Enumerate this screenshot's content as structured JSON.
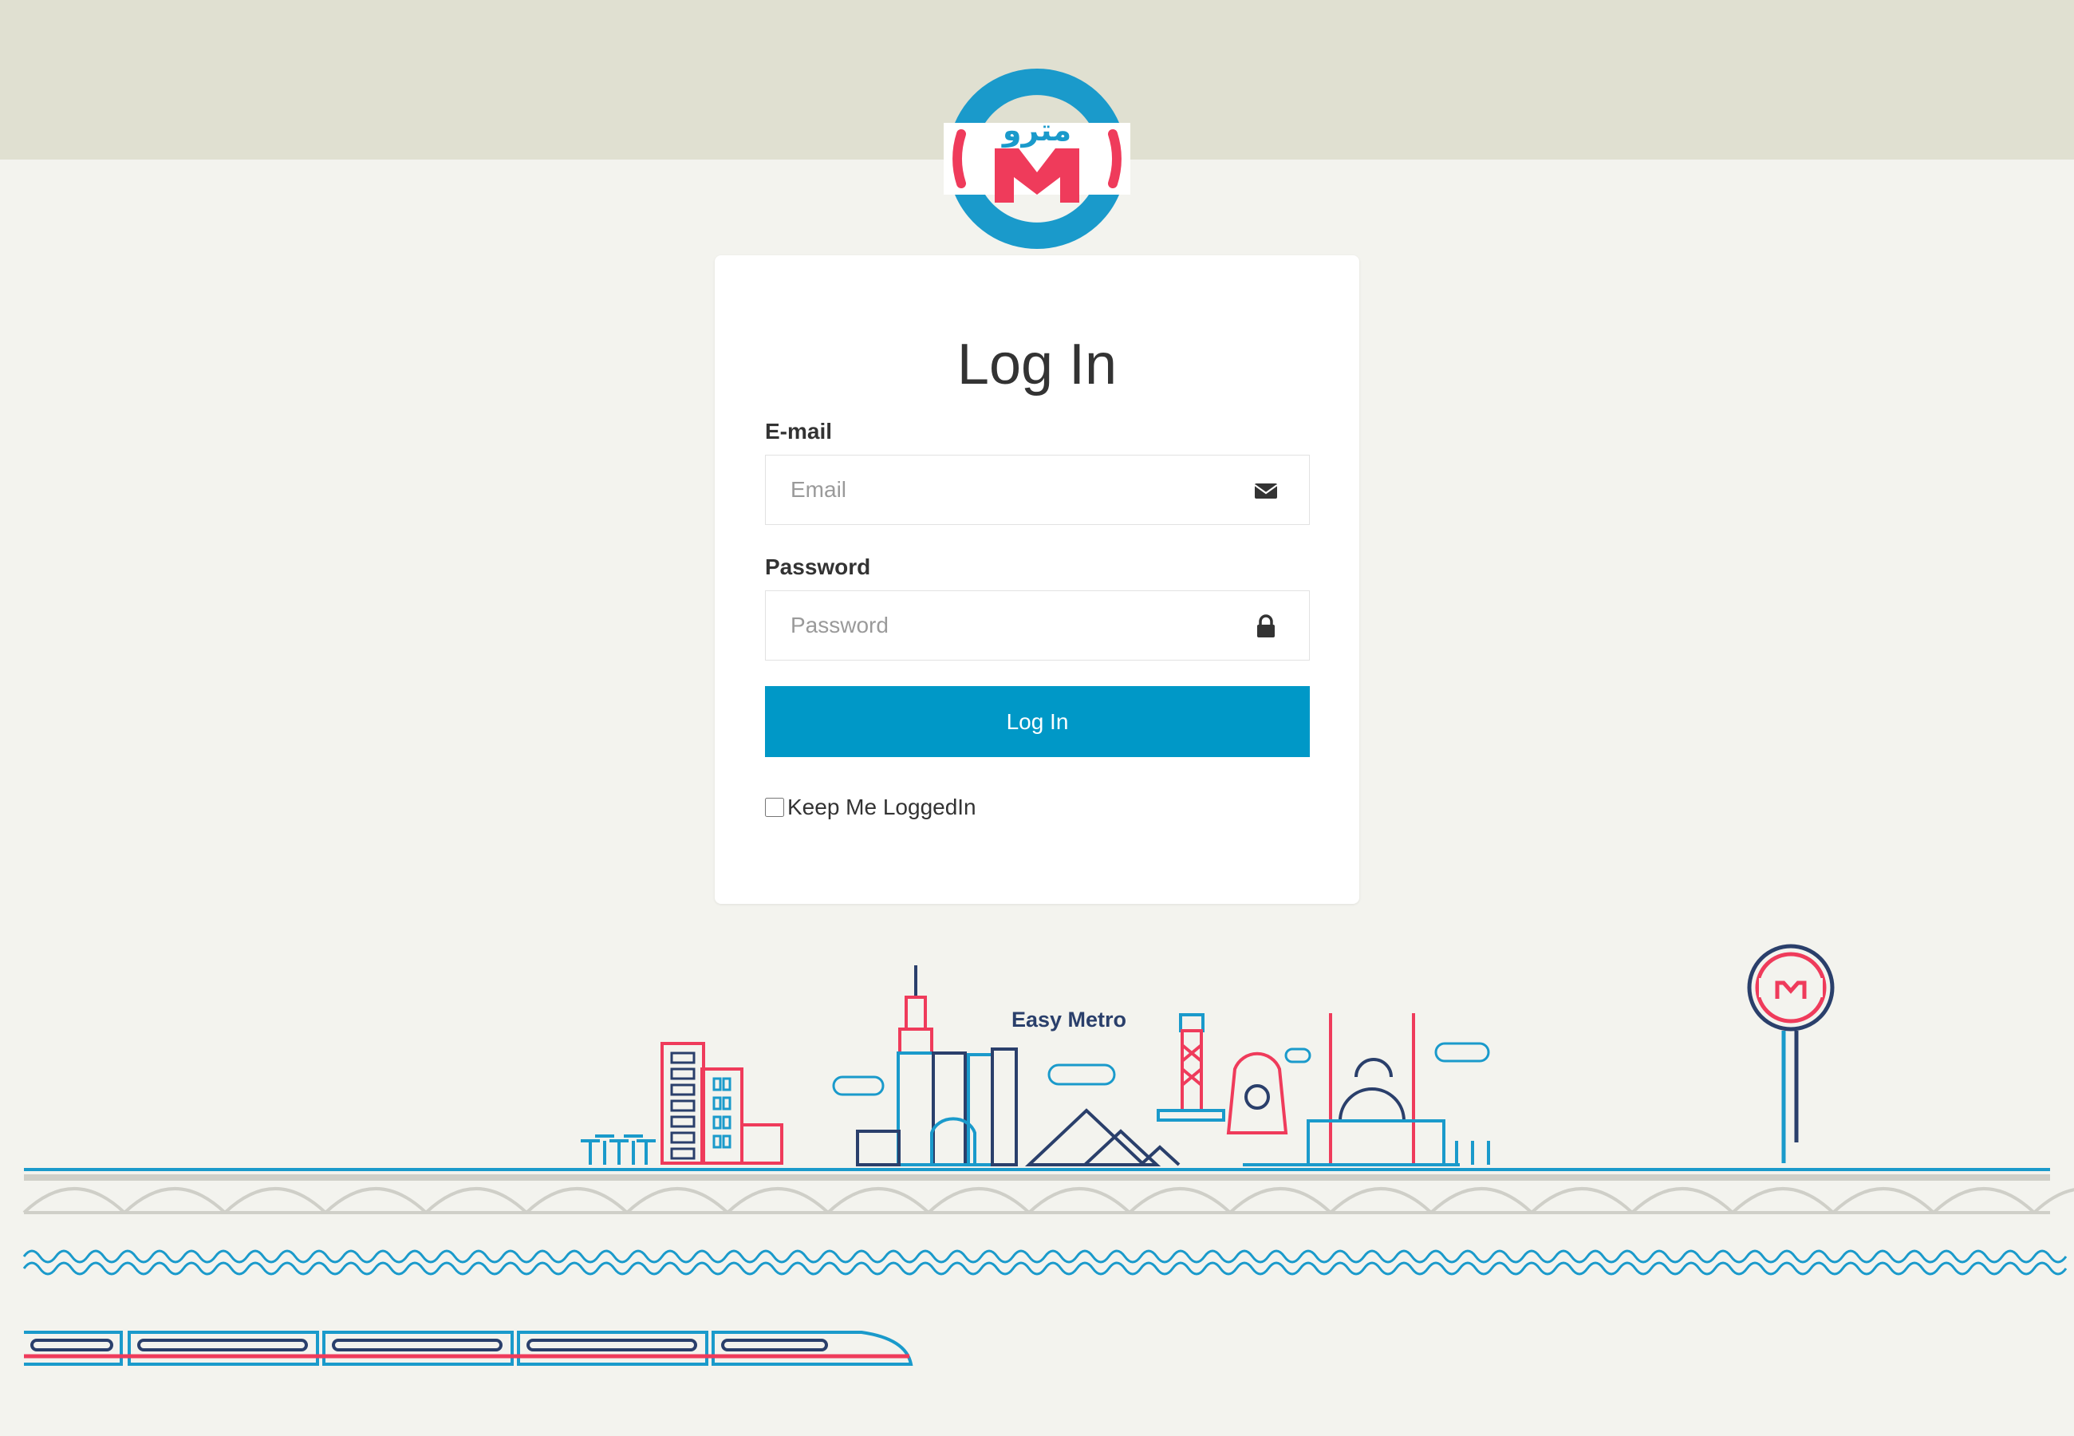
{
  "colors": {
    "accent": "#0098c7",
    "red": "#ef3b5b",
    "navy": "#2a3f6b",
    "top_band": "#e0e0d1",
    "background": "#f3f3ee"
  },
  "logo": {
    "arabic_text": "مترو",
    "letter": "M",
    "icon": "metro-logo"
  },
  "login": {
    "title": "Log In",
    "email": {
      "label": "E-mail",
      "placeholder": "Email",
      "value": "",
      "icon": "envelope-icon"
    },
    "password": {
      "label": "Password",
      "placeholder": "Password",
      "value": "",
      "icon": "lock-icon"
    },
    "submit_label": "Log In",
    "remember_label": "Keep Me LoggedIn",
    "remember_checked": false
  },
  "illustration": {
    "caption": "Easy Metro"
  }
}
